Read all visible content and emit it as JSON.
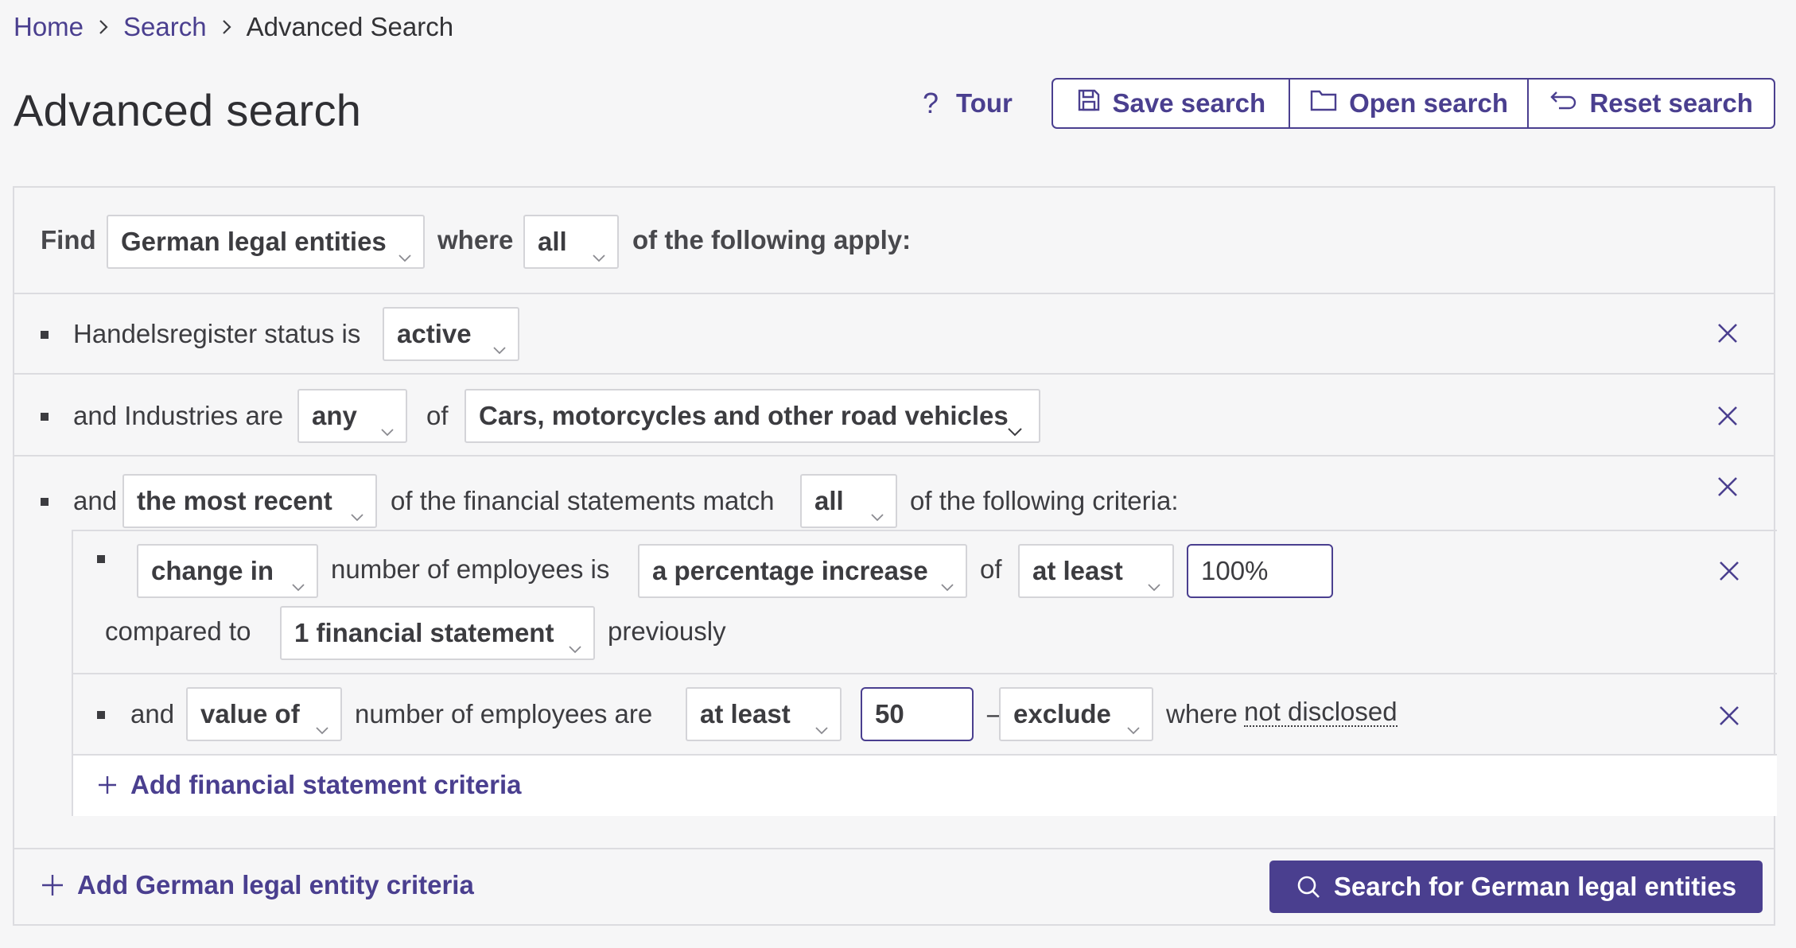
{
  "breadcrumb": {
    "home": "Home",
    "search": "Search",
    "current": "Advanced Search"
  },
  "page_title": "Advanced search",
  "toolbar": {
    "tour": "Tour",
    "save": "Save search",
    "open": "Open search",
    "reset": "Reset search"
  },
  "find_row": {
    "find": "Find",
    "entity": "German legal entities",
    "where": "where",
    "quantifier": "all",
    "suffix": "of the following apply:"
  },
  "status_row": {
    "label": "Handelsregister status is",
    "value": "active"
  },
  "industry_row": {
    "label": "and Industries are",
    "quantifier": "any",
    "of": "of",
    "value": "Cars, motorcycles and other road vehicles"
  },
  "financial_row": {
    "and": "and",
    "statement": "the most recent",
    "middle": "of the financial statements match",
    "quantifier": "all",
    "suffix": "of the following criteria:"
  },
  "criterion_1": {
    "mode": "change in",
    "metric": "number of employees is",
    "change": "a percentage increase",
    "of": "of",
    "comparator": "at least",
    "value": "100%",
    "compared_to": "compared to",
    "period": "1 financial statement",
    "previously": "previously"
  },
  "criterion_2": {
    "and": "and",
    "mode": "value of",
    "metric": "number of employees are",
    "comparator": "at least",
    "value": "50",
    "dash": "–",
    "undisclosed": "exclude",
    "where": "where",
    "not_disclosed": "not disclosed"
  },
  "add_financial": "Add financial statement criteria",
  "add_entity": "Add German legal entity criteria",
  "search_button": "Search for German legal entities",
  "colors": {
    "accent": "#4a3f8f",
    "border": "#dcdce0",
    "background": "#f6f6f7"
  }
}
